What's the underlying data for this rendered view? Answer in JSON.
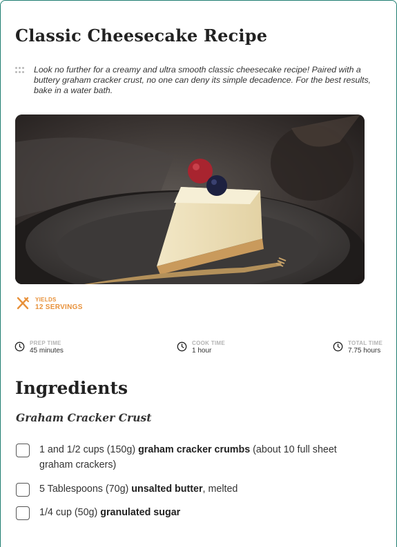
{
  "recipe": {
    "title": "Classic Cheesecake Recipe",
    "summary": "Look no further for a creamy and ultra smooth classic cheesecake recipe! Paired with a buttery graham cracker crust, no one can deny its simple decadence. For the best results, bake in a water bath."
  },
  "image": {
    "alt_name": "cheesecake-slice-photo"
  },
  "yields": {
    "label": "YIELDS",
    "value": "12 SERVINGS",
    "icon": "utensils-icon",
    "color": "#e8913a"
  },
  "times": [
    {
      "label": "PREP TIME",
      "value": "45 minutes",
      "icon": "clock-icon"
    },
    {
      "label": "COOK TIME",
      "value": "1 hour",
      "icon": "clock-icon"
    },
    {
      "label": "TOTAL TIME",
      "value": "7.75 hours",
      "icon": "clock-icon"
    }
  ],
  "ingredients": {
    "heading": "Ingredients",
    "group": "Graham Cracker Crust",
    "items": [
      {
        "pre": "1 and 1/2 cups (150g) ",
        "bold": "graham cracker crumbs",
        "post": " (about 10 full sheet graham crackers)"
      },
      {
        "pre": "5 Tablespoons (70g) ",
        "bold": "unsalted butter",
        "post": ", melted"
      },
      {
        "pre": "1/4 cup (50g) ",
        "bold": "granulated sugar",
        "post": ""
      }
    ]
  },
  "colors": {
    "border": "#1e7d70",
    "accent": "#e8913a"
  }
}
